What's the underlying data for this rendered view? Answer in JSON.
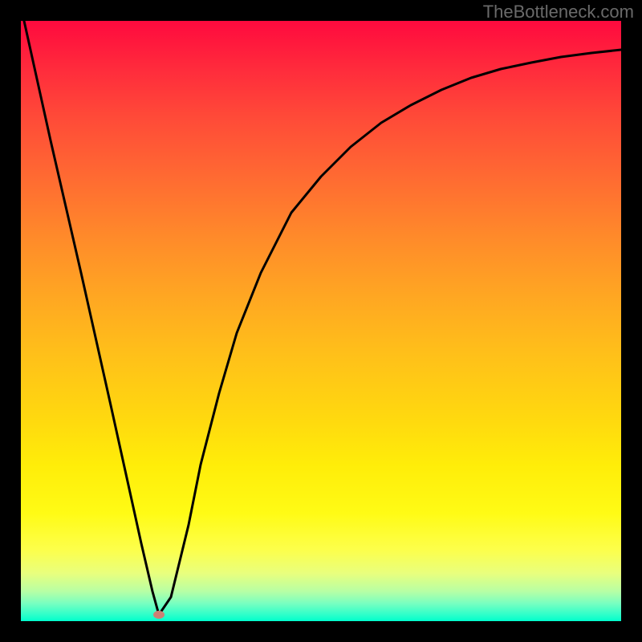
{
  "watermark": "TheBottleneck.com",
  "chart_data": {
    "type": "line",
    "title": "",
    "xlabel": "",
    "ylabel": "",
    "xlim": [
      0,
      100
    ],
    "ylim": [
      0,
      100
    ],
    "grid": false,
    "legend": false,
    "series": [
      {
        "name": "curve",
        "x": [
          0.5,
          5,
          10,
          15,
          18,
          20,
          22,
          23,
          25,
          28,
          30,
          33,
          36,
          40,
          45,
          50,
          55,
          60,
          65,
          70,
          75,
          80,
          85,
          90,
          95,
          100
        ],
        "y": [
          100,
          80,
          58,
          36,
          22,
          13,
          5,
          1,
          4,
          16,
          26,
          38,
          48,
          58,
          68,
          74,
          79,
          83,
          86,
          88.5,
          90.5,
          92,
          93,
          94,
          94.7,
          95.2
        ]
      }
    ],
    "marker": {
      "x": 23,
      "y": 0.5
    },
    "background_gradient": {
      "top": "#ff0a3e",
      "mid_upper": "#ff8a2a",
      "mid": "#ffed09",
      "mid_lower": "#e9ff7d",
      "bottom": "#00ffcc"
    }
  }
}
